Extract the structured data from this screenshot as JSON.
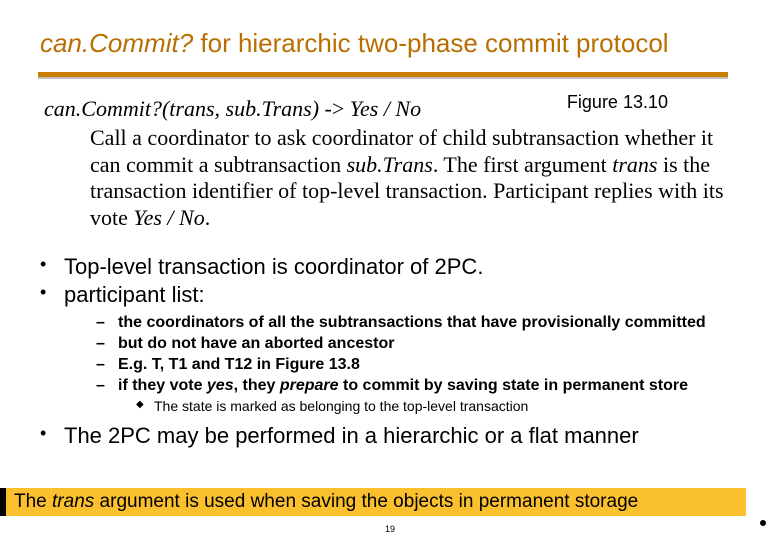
{
  "title": {
    "fn": "can.Commit?",
    "rest": "  for hierarchic two-phase commit protocol"
  },
  "figure_ref": "Figure 13.10",
  "definition": {
    "fn": "can.Commit?",
    "args": "(trans, sub.Trans)",
    "arrow": " -> ",
    "tail": "Yes / No",
    "desc_pre": "Call a coordinator to ask coordinator of child subtransaction whether it can commit a subtransaction ",
    "subTrans": "sub.Trans",
    "desc_mid": ". The first argument ",
    "trans": "trans",
    "desc_mid2": " is the transaction identifier of top-level transaction. Participant replies with its vote ",
    "yesno": "Yes / No",
    "desc_end": "."
  },
  "bullets": {
    "b1a": "Top-level transaction is coordinator of 2PC.",
    "b1b": "participant list:",
    "sub": [
      "the coordinators of all the subtransactions that have provisionally committed",
      "but do not have an aborted ancestor",
      "E.g. T, T1 and T12 in Figure 13.8"
    ],
    "sub4_pre": "if they vote ",
    "sub4_yes": "yes",
    "sub4_mid": ", they ",
    "sub4_prepare": "prepare",
    "sub4_post": " to commit by saving state in permanent store",
    "sub_sub": "The state is marked as belonging to the top-level transaction",
    "b1c": "The 2PC may be performed in a hierarchic or a flat manner"
  },
  "footnote": {
    "lead1": "The ",
    "trans": "trans",
    "lead2": " argument is used when saving the objects in permanent storage"
  },
  "page_number": "19"
}
